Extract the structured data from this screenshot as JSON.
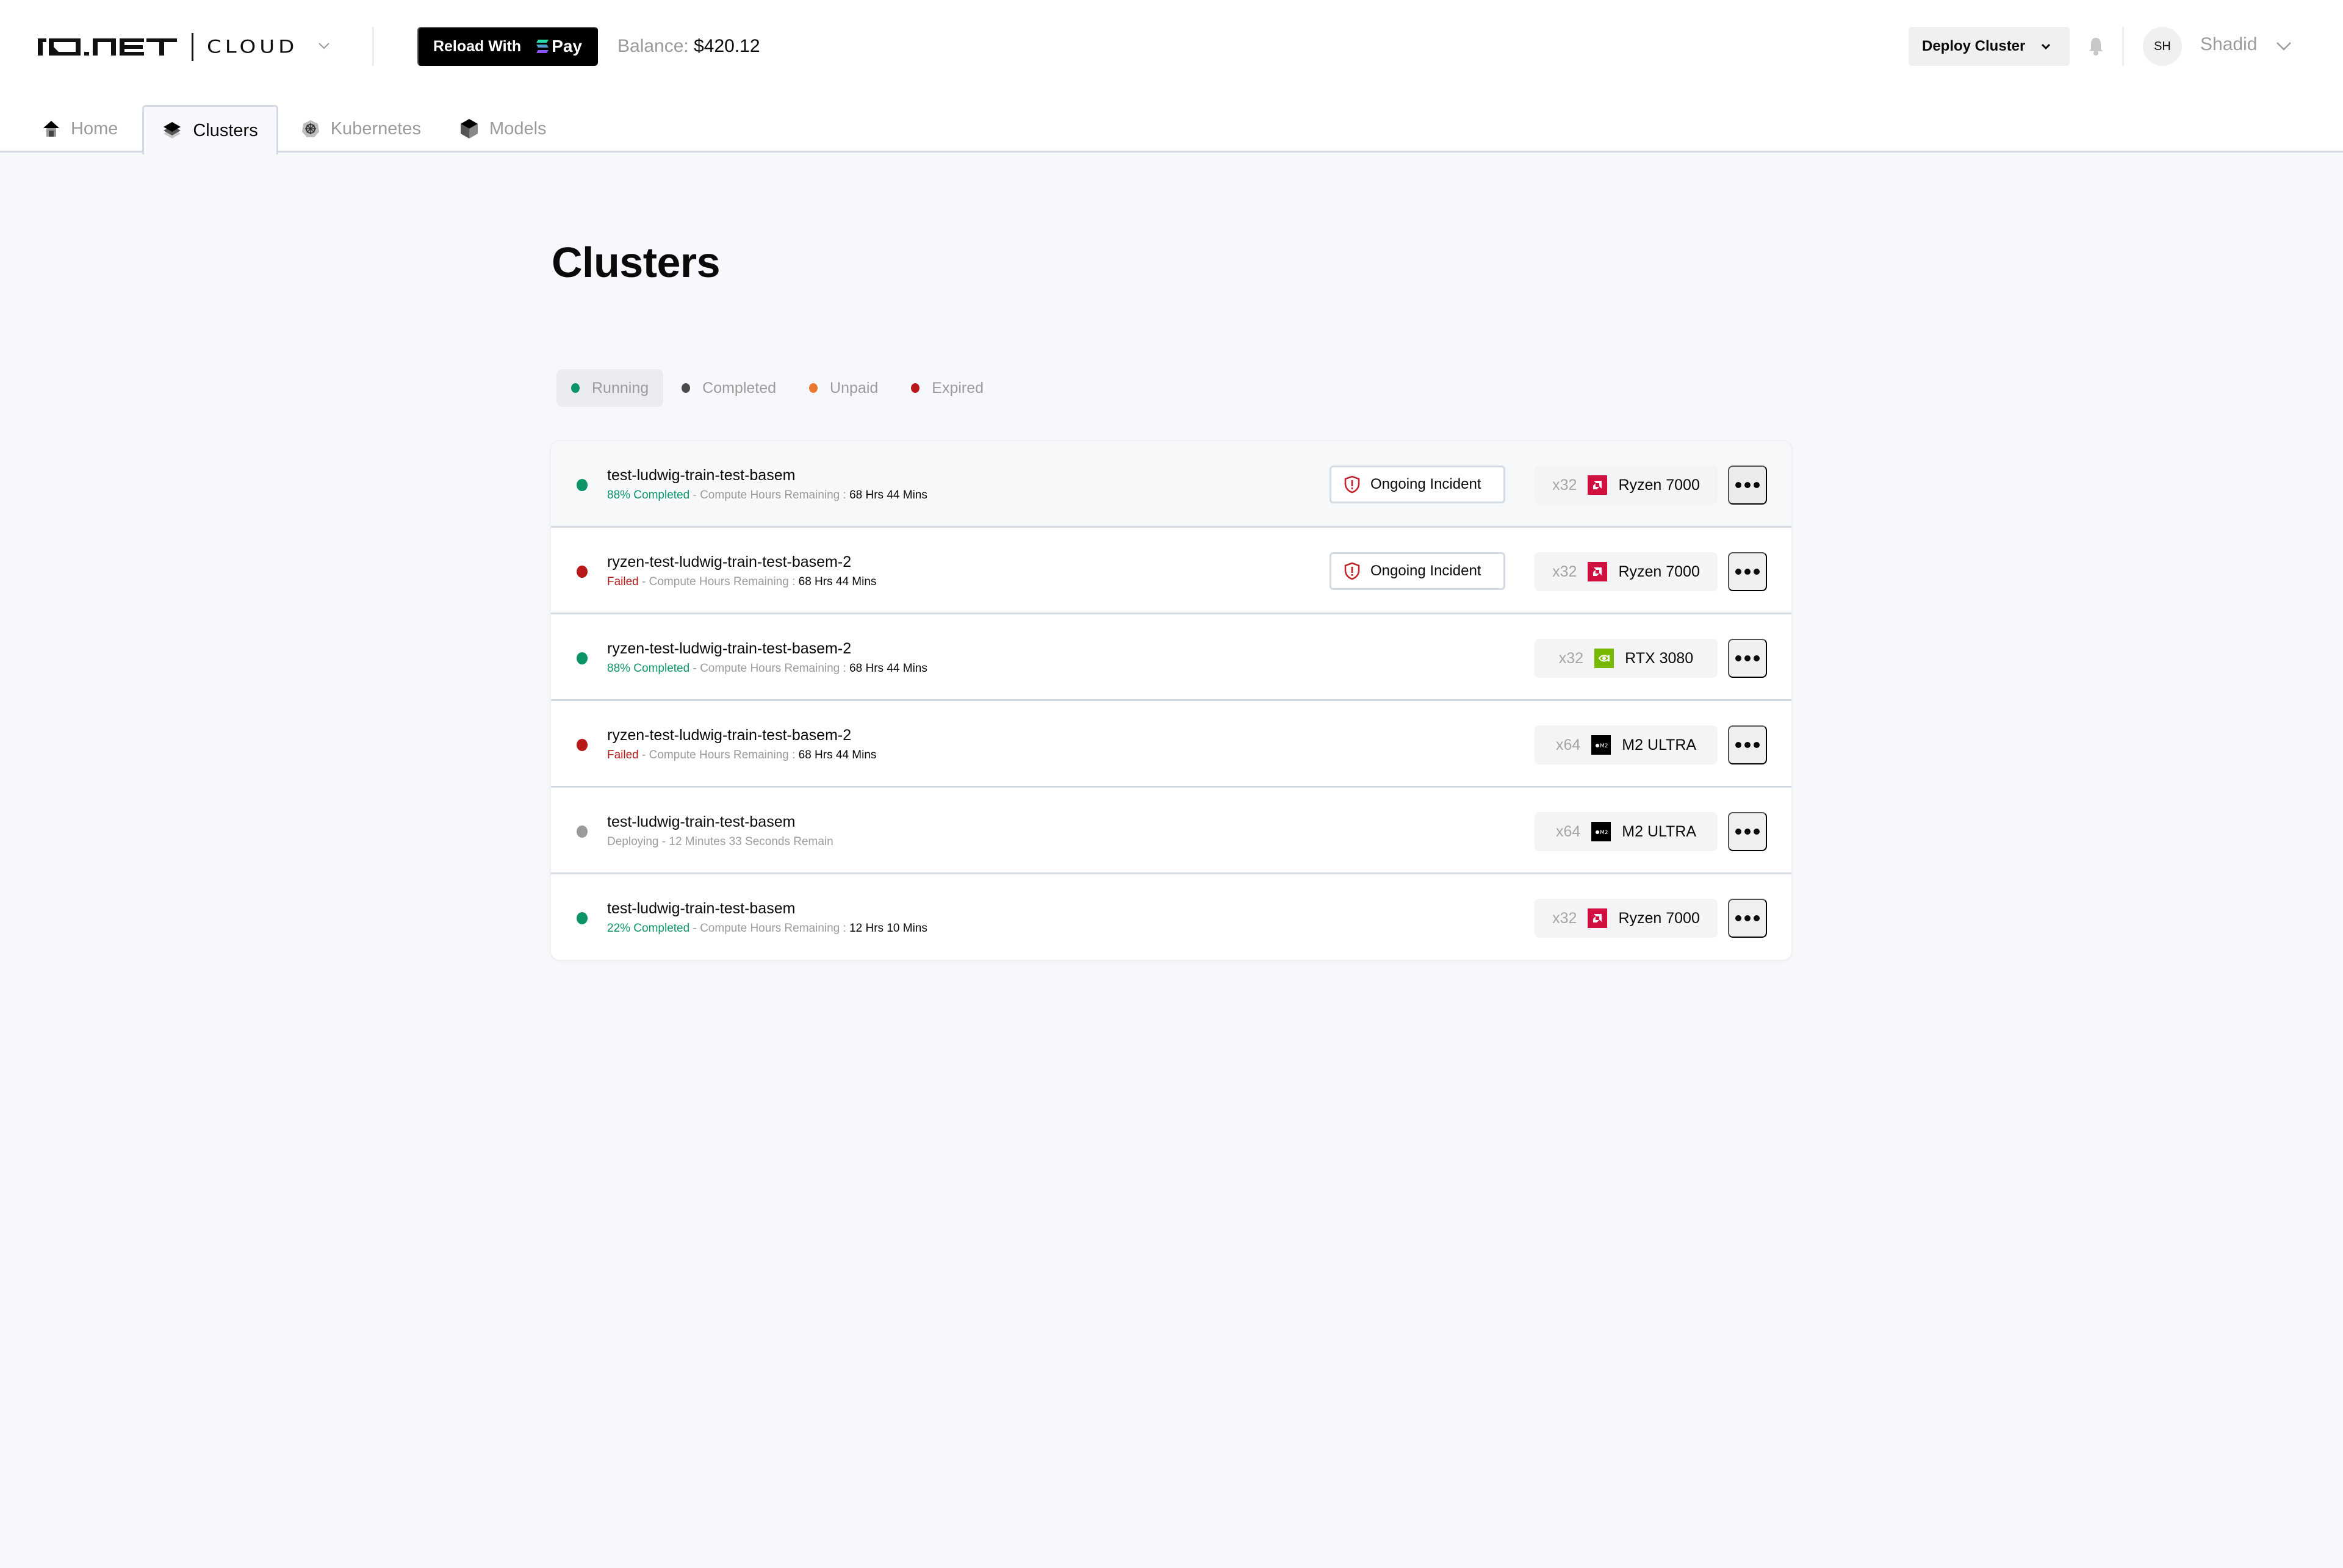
{
  "header": {
    "logo_text": "IO.NET",
    "product": "CLOUD",
    "reload_label": "Reload With",
    "pay_label": "Pay",
    "balance_label": "Balance:",
    "balance_value": "$420.12",
    "deploy_label": "Deploy Cluster",
    "user_initials": "SH",
    "user_name": "Shadid"
  },
  "tabs": [
    {
      "label": "Home",
      "icon": "home-icon",
      "active": false
    },
    {
      "label": "Clusters",
      "icon": "layers-icon",
      "active": true
    },
    {
      "label": "Kubernetes",
      "icon": "kubernetes-icon",
      "active": false
    },
    {
      "label": "Models",
      "icon": "cube-icon",
      "active": false
    }
  ],
  "page": {
    "title": "Clusters"
  },
  "filters": [
    {
      "label": "Running",
      "color": "#0B9467",
      "active": true
    },
    {
      "label": "Completed",
      "color": "#4A4A4A",
      "active": false
    },
    {
      "label": "Unpaid",
      "color": "#E8792F",
      "active": false
    },
    {
      "label": "Expired",
      "color": "#B81A1A",
      "active": false
    }
  ],
  "colors": {
    "green": "#0B9467",
    "red": "#B81A1A",
    "grey": "#9B9B9B",
    "amd": "#D2103F",
    "nvidia": "#76B900",
    "apple": "#000000"
  },
  "clusters": [
    {
      "name": "test-ludwig-train-test-basem",
      "status": "running",
      "status_text": "88% Completed",
      "separator": " - Compute Hours Remaining : ",
      "time": "68 Hrs 44 Mins",
      "incident": "Ongoing Incident",
      "count": "x32",
      "brand": "amd",
      "model": "Ryzen 7000"
    },
    {
      "name": "ryzen-test-ludwig-train-test-basem-2",
      "status": "failed",
      "status_text": "Failed",
      "separator": " - Compute Hours Remaining : ",
      "time": "68 Hrs 44 Mins",
      "incident": "Ongoing Incident",
      "count": "x32",
      "brand": "amd",
      "model": "Ryzen 7000"
    },
    {
      "name": "ryzen-test-ludwig-train-test-basem-2",
      "status": "running",
      "status_text": "88% Completed",
      "separator": " - Compute Hours Remaining : ",
      "time": "68 Hrs 44 Mins",
      "incident": null,
      "count": "x32",
      "brand": "nvidia",
      "model": "RTX 3080"
    },
    {
      "name": "ryzen-test-ludwig-train-test-basem-2",
      "status": "failed",
      "status_text": "Failed",
      "separator": " - Compute Hours Remaining : ",
      "time": "68 Hrs 44 Mins",
      "incident": null,
      "count": "x64",
      "brand": "apple",
      "model": "M2 ULTRA"
    },
    {
      "name": "test-ludwig-train-test-basem",
      "status": "deploying",
      "status_text": "Deploying - 12 Minutes 33 Seconds Remain",
      "separator": "",
      "time": "",
      "incident": null,
      "count": "x64",
      "brand": "apple",
      "model": "M2 ULTRA"
    },
    {
      "name": "test-ludwig-train-test-basem",
      "status": "running",
      "status_text": "22% Completed",
      "separator": " - Compute Hours Remaining : ",
      "time": "12 Hrs 10 Mins",
      "incident": null,
      "count": "x32",
      "brand": "amd",
      "model": "Ryzen 7000"
    }
  ]
}
